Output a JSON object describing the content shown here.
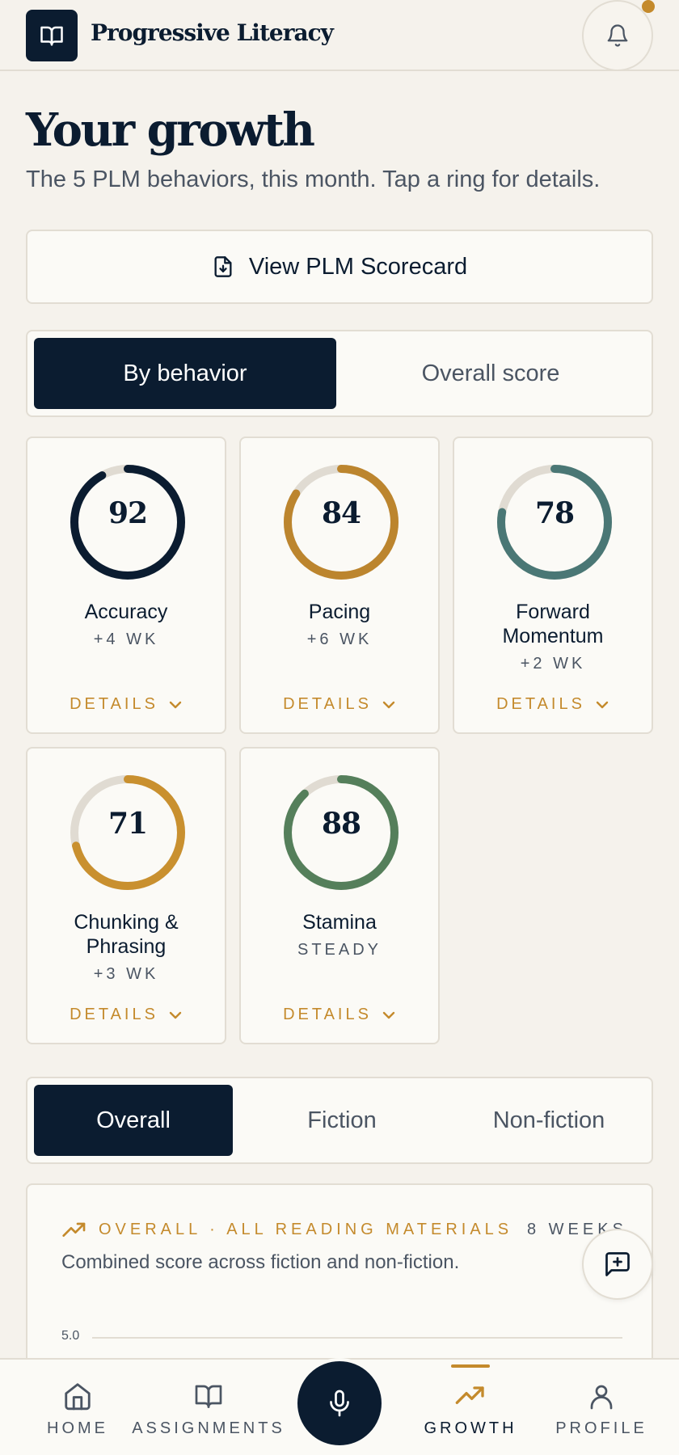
{
  "header": {
    "brand": "Progressive Literacy"
  },
  "page": {
    "title": "Your growth",
    "subtitle": "The 5 PLM behaviors, this month. Tap a ring for details."
  },
  "scorecard": {
    "label": "View PLM Scorecard"
  },
  "view_toggle": {
    "options": [
      "By behavior",
      "Overall score"
    ],
    "selected": "By behavior"
  },
  "behaviors": [
    {
      "name": "Accuracy",
      "score": "92",
      "trend": "+4 WK",
      "details": "DETAILS",
      "color": "#0b1c30"
    },
    {
      "name": "Pacing",
      "score": "84",
      "trend": "+6 WK",
      "details": "DETAILS",
      "color": "#bc852e"
    },
    {
      "name": "Forward Momentum",
      "score": "78",
      "trend": "+2 WK",
      "details": "DETAILS",
      "color": "#4a7775"
    },
    {
      "name": "Chunking & Phrasing",
      "score": "71",
      "trend": "+3 WK",
      "details": "DETAILS",
      "color": "#c9902f"
    },
    {
      "name": "Stamina",
      "score": "88",
      "trend": "STEADY",
      "details": "DETAILS",
      "color": "#557f5b"
    }
  ],
  "material_toggle": {
    "options": [
      "Overall",
      "Fiction",
      "Non-fiction"
    ],
    "selected": "Overall"
  },
  "chart_card": {
    "eyebrow": "OVERALL · ALL READING MATERIALS",
    "range": "8 WEEKS",
    "description": "Combined score across fiction and non-fiction.",
    "y_tick_top": "5.0"
  },
  "bottom_nav": {
    "items": [
      {
        "label": "HOME",
        "icon": "home-icon"
      },
      {
        "label": "ASSIGNMENTS",
        "icon": "book-open-icon"
      },
      {
        "label": "GROWTH",
        "icon": "trending-up-icon"
      },
      {
        "label": "PROFILE",
        "icon": "user-icon"
      }
    ],
    "active": "GROWTH"
  },
  "colors": {
    "navy": "#0b1c30",
    "gold": "#c48a2c",
    "track": "#e0dbd2",
    "background": "#f5f2ec"
  }
}
